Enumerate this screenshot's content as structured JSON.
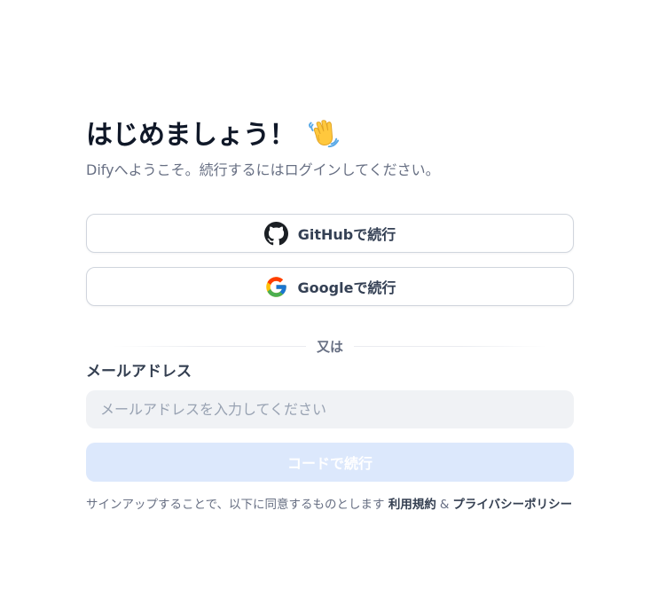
{
  "header": {
    "title": "はじめましょう！",
    "wave_emoji": "waving-hand-icon",
    "subtitle": "Difyへようこそ。続行するにはログインしてください。"
  },
  "social_login": {
    "github_label": "GitHubで続行",
    "github_icon": "github-icon",
    "google_label": "Googleで続行",
    "google_icon": "google-icon"
  },
  "divider": {
    "text": "又は"
  },
  "email_form": {
    "label": "メールアドレス",
    "placeholder": "メールアドレスを入力してください",
    "value": "",
    "submit_label": "コードで続行",
    "submit_disabled": true
  },
  "terms": {
    "prefix": "サインアップすることで、以下に同意するものとします",
    "terms_link": "利用規約",
    "ampersand": "&",
    "privacy_link": "プライバシーポリシー"
  },
  "colors": {
    "primary_disabled": "#dce8fc",
    "input_bg": "#f0f2f5",
    "text_primary": "#101828",
    "text_secondary": "#676f83"
  }
}
